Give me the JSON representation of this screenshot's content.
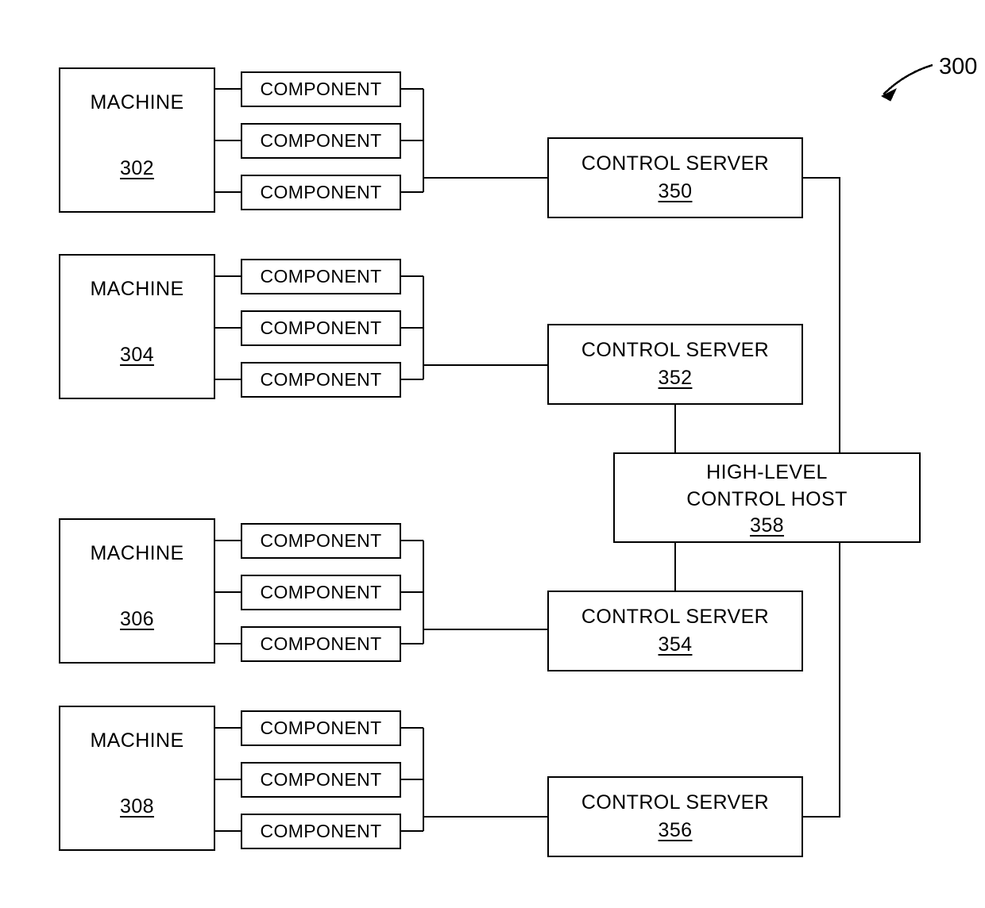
{
  "figure": {
    "label": "300",
    "leader_icon": "curved-arrow-icon"
  },
  "machines": [
    {
      "title": "MACHINE",
      "refnum": "302",
      "components": [
        {
          "title": "COMPONENT"
        },
        {
          "title": "COMPONENT"
        },
        {
          "title": "COMPONENT"
        }
      ]
    },
    {
      "title": "MACHINE",
      "refnum": "304",
      "components": [
        {
          "title": "COMPONENT"
        },
        {
          "title": "COMPONENT"
        },
        {
          "title": "COMPONENT"
        }
      ]
    },
    {
      "title": "MACHINE",
      "refnum": "306",
      "components": [
        {
          "title": "COMPONENT"
        },
        {
          "title": "COMPONENT"
        },
        {
          "title": "COMPONENT"
        }
      ]
    },
    {
      "title": "MACHINE",
      "refnum": "308",
      "components": [
        {
          "title": "COMPONENT"
        },
        {
          "title": "COMPONENT"
        },
        {
          "title": "COMPONENT"
        }
      ]
    }
  ],
  "servers": [
    {
      "title": "CONTROL SERVER",
      "refnum": "350"
    },
    {
      "title": "CONTROL SERVER",
      "refnum": "352"
    },
    {
      "title": "CONTROL SERVER",
      "refnum": "354"
    },
    {
      "title": "CONTROL SERVER",
      "refnum": "356"
    }
  ],
  "host": {
    "title_line1": "HIGH-LEVEL",
    "title_line2": "CONTROL HOST",
    "refnum": "358"
  },
  "style": {
    "stroke": "#000000",
    "background": "#ffffff"
  }
}
